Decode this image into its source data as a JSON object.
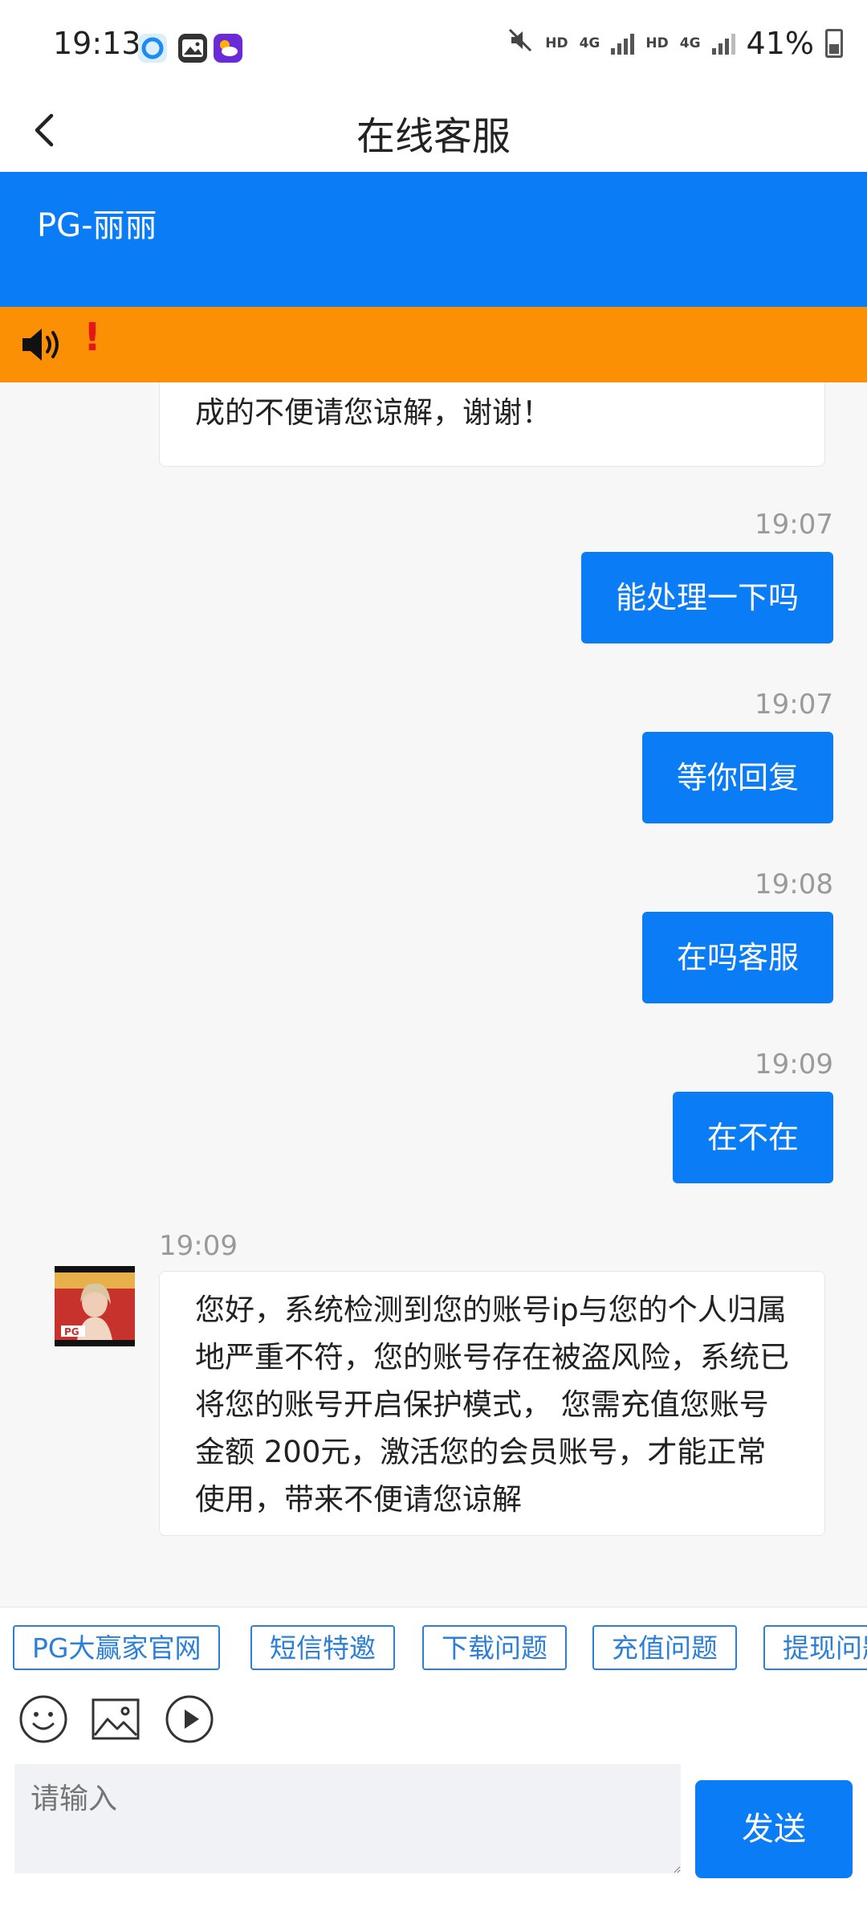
{
  "status_bar": {
    "time": "19:13",
    "battery": "41%",
    "network_1": "HD",
    "network_2": "4G",
    "network_3": "HD",
    "network_4": "4G"
  },
  "nav": {
    "title": "在线客服"
  },
  "agent": {
    "name": "PG-丽丽"
  },
  "notice": {
    "alert_symbol": "!"
  },
  "messages": [
    {
      "side": "in",
      "time": "",
      "text": "请您耐心等待，专员正在下载游戏中，给您造成的不便请您谅解，谢谢！"
    },
    {
      "side": "out",
      "time": "19:07",
      "text": "能处理一下吗"
    },
    {
      "side": "out",
      "time": "19:07",
      "text": "等你回复"
    },
    {
      "side": "out",
      "time": "19:08",
      "text": "在吗客服"
    },
    {
      "side": "out",
      "time": "19:09",
      "text": "在不在"
    },
    {
      "side": "in",
      "time": "19:09",
      "text": "您好，系统检测到您的账号ip与您的个人归属地严重不符，您的账号存在被盗风险，系统已将您的账号开启保护模式， 您需充值您账号金额 200元，激活您的会员账号，才能正常使用，带来不便请您谅解"
    }
  ],
  "avatar": {
    "label": "PG"
  },
  "quick_replies": [
    "PG大赢家官网",
    "短信特邀",
    "下载问题",
    "充值问题",
    "提现问题"
  ],
  "tools": {
    "emoji": "emoji-icon",
    "image": "image-icon",
    "video": "video-icon"
  },
  "input": {
    "placeholder": "请输入",
    "value": ""
  },
  "send": {
    "label": "发送"
  },
  "colors": {
    "primary": "#0a7cf5",
    "notice": "#fb9004",
    "alert": "#e31717"
  }
}
